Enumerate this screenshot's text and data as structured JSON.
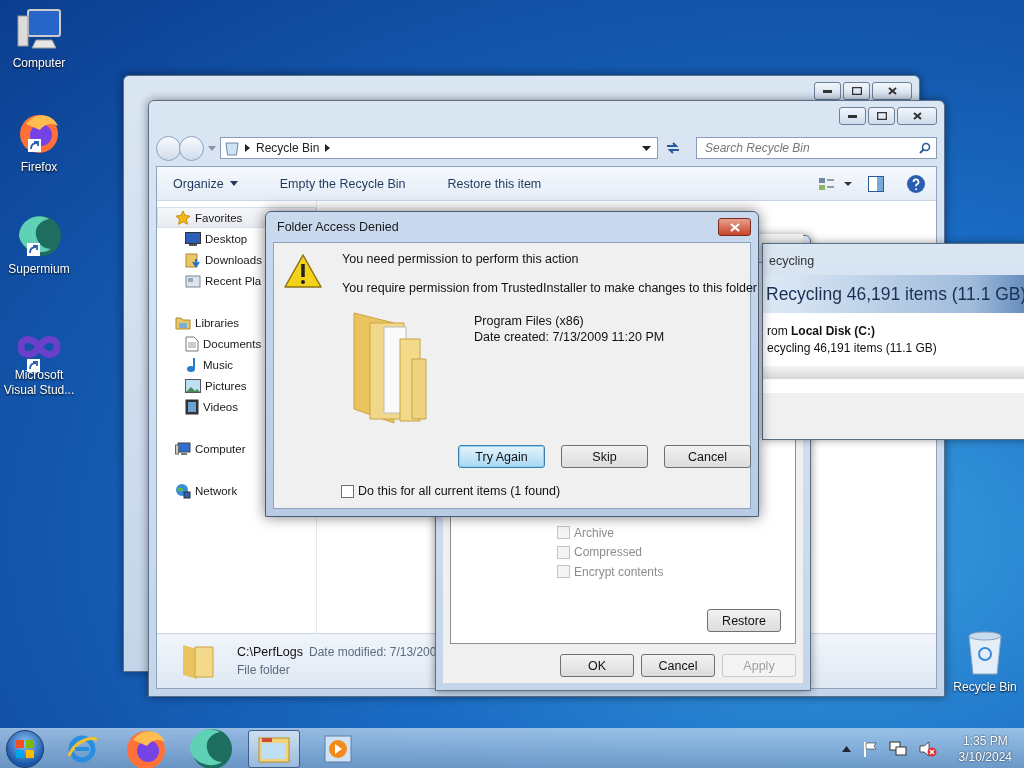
{
  "desktop_icons": [
    {
      "label": "Computer",
      "kind": "computer",
      "shortcut": false
    },
    {
      "label": "Firefox",
      "kind": "firefox",
      "shortcut": true
    },
    {
      "label": "Supermium",
      "kind": "supermium",
      "shortcut": true
    },
    {
      "label": "Microsoft Visual Stud...",
      "kind": "visualstudio",
      "shortcut": true
    }
  ],
  "recycle_bin": {
    "label": "Recycle Bin"
  },
  "explorer": {
    "address": "Recycle Bin",
    "search": {
      "placeholder": "Search Recycle Bin"
    },
    "toolbar": [
      {
        "label": "Organize",
        "dropdown": true
      },
      {
        "label": "Empty the Recycle Bin",
        "dropdown": false
      },
      {
        "label": "Restore this item",
        "dropdown": false
      }
    ],
    "nav": [
      {
        "label": "Favorites",
        "kind": "star",
        "selected": true,
        "children": [
          {
            "label": "Desktop",
            "kind": "desktop",
            "selected": false
          },
          {
            "label": "Downloads",
            "kind": "downloads",
            "selected": false
          },
          {
            "label": "Recent Pla",
            "kind": "recent",
            "selected": false
          }
        ]
      },
      {
        "label": "Libraries",
        "kind": "libraries",
        "selected": false,
        "children": [
          {
            "label": "Documents",
            "kind": "documents",
            "selected": false
          },
          {
            "label": "Music",
            "kind": "music",
            "selected": false
          },
          {
            "label": "Pictures",
            "kind": "pictures",
            "selected": false
          },
          {
            "label": "Videos",
            "kind": "videos",
            "selected": false
          }
        ]
      },
      {
        "label": "Computer",
        "kind": "computer",
        "selected": false
      },
      {
        "label": "Network",
        "kind": "network",
        "selected": false
      }
    ],
    "details": {
      "name": "C:\\PerfLogs",
      "modified": "Date modified: 7/13/200",
      "type": "File folder"
    }
  },
  "properties_window": {
    "attributes": [
      {
        "label": "Archive",
        "checked": false,
        "disabled": true
      },
      {
        "label": "Compressed",
        "checked": false,
        "disabled": true
      },
      {
        "label": "Encrypt contents",
        "checked": false,
        "disabled": true
      }
    ],
    "restore_button": "Restore",
    "buttons": [
      {
        "label": "OK",
        "disabled": false
      },
      {
        "label": "Cancel",
        "disabled": false
      },
      {
        "label": "Apply",
        "disabled": true
      }
    ]
  },
  "progress_window": {
    "title": "ecycling",
    "header": "Recycling 46,191 items (11.1 GB)",
    "from": "rom **Local Disk (C:)**",
    "status": "ecycling 46,191 items (11.1 GB)"
  },
  "dialog": {
    "title": "Folder Access Denied",
    "message": "You need permission to perform this action",
    "detail": "You require permission from TrustedInstaller to make changes to this folder",
    "item_name": "Program Files (x86)",
    "item_date": "Date created: 7/13/2009 11:20 PM",
    "buttons": [
      {
        "label": "Try Again",
        "default": true
      },
      {
        "label": "Skip",
        "default": false
      },
      {
        "label": "Cancel",
        "default": false
      }
    ],
    "apply_all": {
      "label": "Do this for all current items (1 found)",
      "checked": false
    }
  },
  "taskbar": {
    "apps": [
      {
        "kind": "ie",
        "active": false
      },
      {
        "kind": "firefox",
        "active": false
      },
      {
        "kind": "supermium",
        "active": false
      },
      {
        "kind": "explorer",
        "active": true
      },
      {
        "kind": "media",
        "active": false
      }
    ],
    "time": "1:35 PM",
    "date": "3/10/2024"
  }
}
